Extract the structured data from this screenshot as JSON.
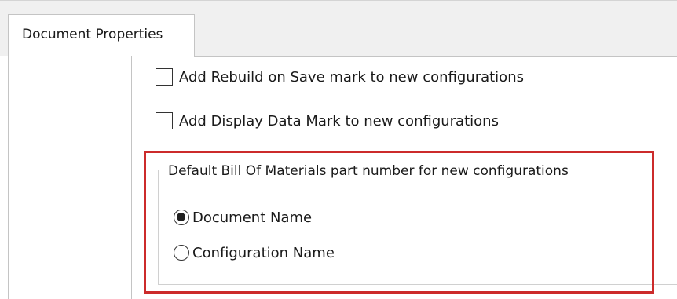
{
  "tabs": [
    {
      "label": "Document Properties",
      "selected": true
    }
  ],
  "options": {
    "rebuild_mark": {
      "label": "Add Rebuild on Save mark to new configurations",
      "checked": false
    },
    "display_data_mark": {
      "label": "Add Display Data Mark to new configurations",
      "checked": false
    }
  },
  "bom_group": {
    "title": "Default Bill Of Materials part number for new configurations",
    "radios": [
      {
        "label": "Document Name",
        "selected": true
      },
      {
        "label": "Configuration Name",
        "selected": false
      }
    ]
  },
  "colors": {
    "highlight": "#cc2b2b",
    "tab_strip_bg": "#f0f0f0",
    "border": "#c4c4c4"
  }
}
